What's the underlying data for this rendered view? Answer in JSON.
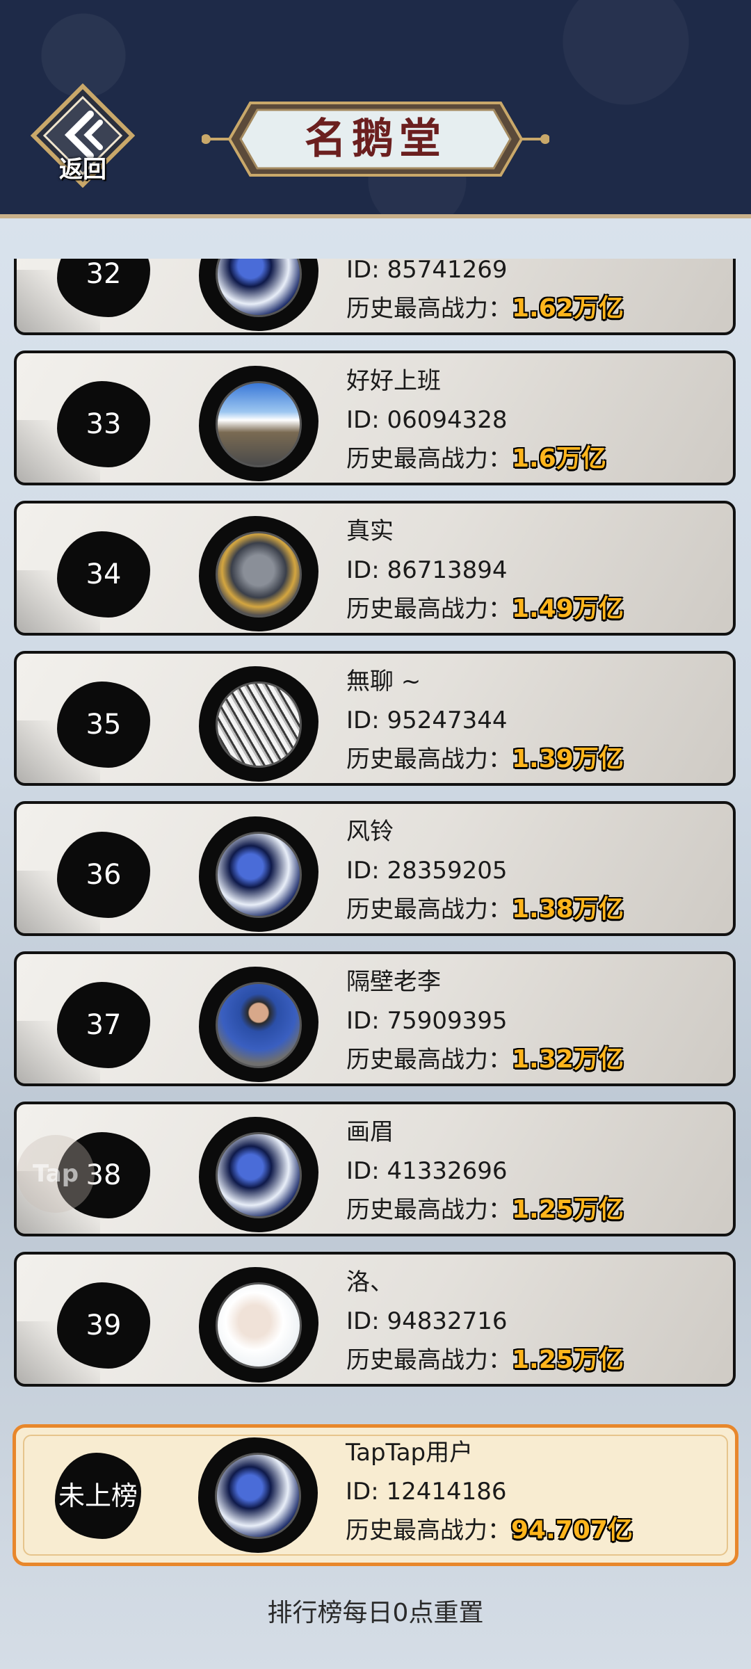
{
  "header": {
    "back_label": "返回",
    "title": "名鹅堂"
  },
  "entries": [
    {
      "rank": "32",
      "name": "",
      "id": "ID: 85741269",
      "power_label": "历史最高战力：",
      "power": "1.62万亿",
      "avatar": "blue-mech-icon"
    },
    {
      "rank": "33",
      "name": "好好上班",
      "id": "ID: 06094328",
      "power_label": "历史最高战力：",
      "power": "1.6万亿",
      "avatar": "road-landscape-photo"
    },
    {
      "rank": "34",
      "name": "真实",
      "id": "ID: 86713894",
      "power_label": "历史最高战力：",
      "power": "1.49万亿",
      "avatar": "creature-portrait"
    },
    {
      "rank": "35",
      "name": "無聊 ~",
      "id": "ID: 95247344",
      "power_label": "历史最高战力：",
      "power": "1.39万亿",
      "avatar": "anime-girl-sketch"
    },
    {
      "rank": "36",
      "name": "风铃",
      "id": "ID: 28359205",
      "power_label": "历史最高战力：",
      "power": "1.38万亿",
      "avatar": "blue-mech-icon"
    },
    {
      "rank": "37",
      "name": "隔壁老李",
      "id": "ID: 75909395",
      "power_label": "历史最高战力：",
      "power": "1.32万亿",
      "avatar": "man-portrait-photo"
    },
    {
      "rank": "38",
      "name": "画眉",
      "id": "ID: 41332696",
      "power_label": "历史最高战力：",
      "power": "1.25万亿",
      "avatar": "blue-mech-icon"
    },
    {
      "rank": "39",
      "name": "洛、",
      "id": "ID: 94832716",
      "power_label": "历史最高战力：",
      "power": "1.25万亿",
      "avatar": "pale-face-portrait"
    }
  ],
  "mine": {
    "rank": "未上榜",
    "name": "TapTap用户",
    "id": "ID: 12414186",
    "power_label": "历史最高战力：",
    "power": "94.707亿",
    "avatar": "blue-mech-icon"
  },
  "footer_note": "排行榜每日0点重置",
  "watermark": "Tap",
  "colors": {
    "header_bg": "#1e2a48",
    "power_gold": "#ffb51c",
    "title_red": "#6b1f1f",
    "mine_border": "#e8872b"
  }
}
